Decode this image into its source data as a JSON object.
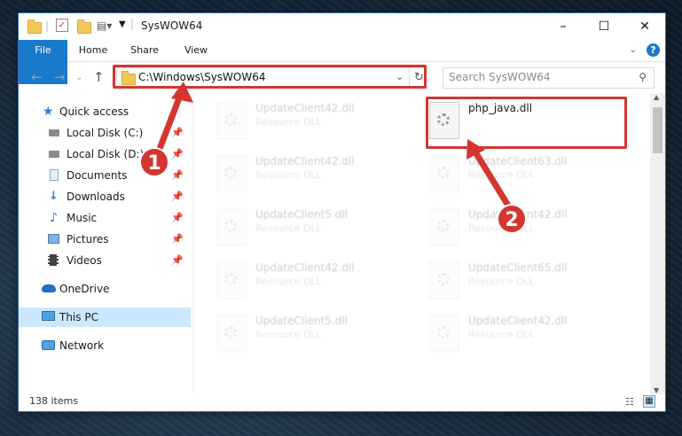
{
  "window": {
    "title": "SysWOW64",
    "controls": {
      "minimize": "–",
      "maximize": "☐",
      "close": "✕"
    }
  },
  "ribbon": {
    "tabs": [
      "File",
      "Home",
      "Share",
      "View"
    ],
    "expand_icon": "chevron-down-icon",
    "help_icon": "help-icon"
  },
  "address": {
    "path": "C:\\Windows\\SysWOW64",
    "search_placeholder": "Search SysWOW64"
  },
  "sidebar": {
    "items": [
      {
        "label": "Quick access",
        "icon": "star-icon"
      },
      {
        "label": "Local Disk (C:)",
        "icon": "drive-icon",
        "pinned": true
      },
      {
        "label": "Local Disk (D:)",
        "icon": "drive-icon",
        "pinned": true
      },
      {
        "label": "Documents",
        "icon": "documents-icon",
        "pinned": true
      },
      {
        "label": "Downloads",
        "icon": "download-icon",
        "pinned": true
      },
      {
        "label": "Music",
        "icon": "music-icon",
        "pinned": true
      },
      {
        "label": "Pictures",
        "icon": "pictures-icon",
        "pinned": true
      },
      {
        "label": "Videos",
        "icon": "videos-icon",
        "pinned": true
      },
      {
        "label": "OneDrive",
        "icon": "cloud-icon"
      },
      {
        "label": "This PC",
        "icon": "computer-icon",
        "selected": true
      },
      {
        "label": "Network",
        "icon": "network-icon"
      }
    ]
  },
  "files": [
    {
      "name": "UpdateClient42.dll",
      "desc": "Resource DLL",
      "faded": true
    },
    {
      "name": "php_java.dll",
      "desc": "",
      "faded": false
    },
    {
      "name": "UpdateClient42.dll",
      "desc": "Resource DLL",
      "faded": true
    },
    {
      "name": "UpdateClient63.dll",
      "desc": "Resource DLL",
      "faded": true
    },
    {
      "name": "UpdateClient5.dll",
      "desc": "Resource DLL",
      "faded": true
    },
    {
      "name": "UpdateClient42.dll",
      "desc": "Resource DLL",
      "faded": true
    },
    {
      "name": "UpdateClient42.dll",
      "desc": "Resource DLL",
      "faded": true
    },
    {
      "name": "UpdateClient65.dll",
      "desc": "Resource DLL",
      "faded": true
    },
    {
      "name": "UpdateClient5.dll",
      "desc": "Resource DLL",
      "faded": true
    },
    {
      "name": "UpdateClient42.dll",
      "desc": "Resource DLL",
      "faded": true
    }
  ],
  "status": {
    "item_count": "138 items"
  },
  "callouts": {
    "one": "1",
    "two": "2"
  },
  "colors": {
    "accent": "#1979ca",
    "highlight": "#d4362f",
    "selected": "#cce8ff"
  }
}
